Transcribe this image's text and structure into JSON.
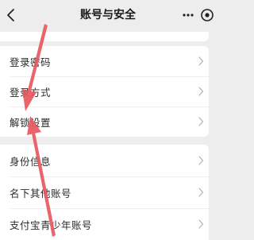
{
  "header": {
    "title": "账号与安全",
    "back_icon": "chevron-left-icon",
    "more_icon": "more-dots-icon",
    "target_icon": "target-circle-icon"
  },
  "sections": [
    {
      "items": [
        {
          "label": "登录密码",
          "icon": "chevron-right-icon"
        },
        {
          "label": "登录方式",
          "icon": "chevron-right-icon"
        },
        {
          "label": "解锁设置",
          "icon": "chevron-right-icon"
        }
      ]
    },
    {
      "items": [
        {
          "label": "身份信息",
          "icon": "chevron-right-icon"
        },
        {
          "label": "名下其他账号",
          "icon": "chevron-right-icon"
        },
        {
          "label": "支付宝青少年账号",
          "icon": "chevron-right-icon"
        }
      ]
    }
  ],
  "annotation": {
    "arrow_color": "#e8585f",
    "arrow_icon": "red-arrow-icon"
  }
}
